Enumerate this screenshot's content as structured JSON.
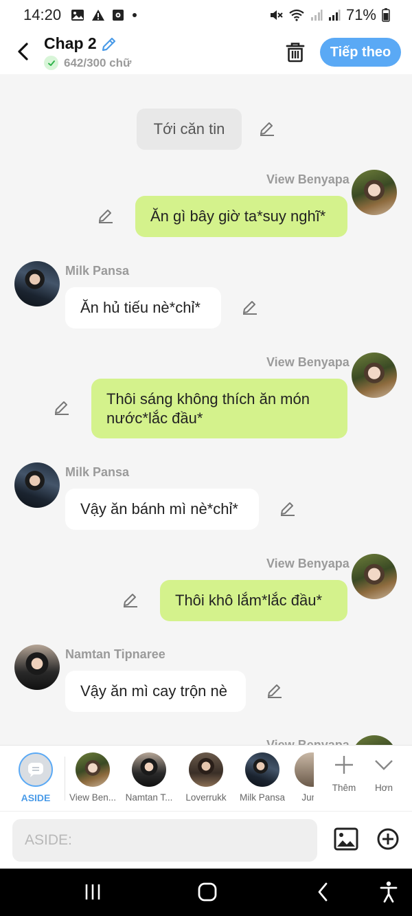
{
  "status_bar": {
    "time": "14:20",
    "battery": "71%",
    "icons": [
      "image-icon",
      "warning-icon",
      "clipboard-icon",
      "dot-icon",
      "mute-icon",
      "wifi-icon",
      "signal-icon",
      "signal-icon",
      "battery-icon"
    ]
  },
  "header": {
    "title": "Chap 2",
    "word_count": "642/300 chữ",
    "next_label": "Tiếp theo",
    "accent_color": "#5aa9f5"
  },
  "messages": [
    {
      "type": "narration",
      "text": "Tới căn tin"
    },
    {
      "type": "right",
      "sender": "View Benyapa",
      "text": "Ăn gì bây giờ ta*suy nghĩ*"
    },
    {
      "type": "left",
      "sender": "Milk Pansa",
      "text": "Ăn hủ tiếu nè*chỉ*"
    },
    {
      "type": "right",
      "sender": "View Benyapa",
      "lines": [
        "Thôi sáng không thích ăn món",
        "nước*lắc đầu*"
      ]
    },
    {
      "type": "left",
      "sender": "Milk Pansa",
      "text": "Vậy ăn bánh mì nè*chỉ*"
    },
    {
      "type": "right",
      "sender": "View Benyapa",
      "text": "Thôi khô lắm*lắc đầu*"
    },
    {
      "type": "left",
      "sender": "Namtan Tipnaree",
      "text": "Vậy ăn mì cay trộn nè"
    },
    {
      "type": "right",
      "sender": "View Benyapa",
      "text": ""
    }
  ],
  "characters": {
    "aside_label": "ASIDE",
    "items": [
      "View Ben...",
      "Namtan T...",
      "Loverrukk",
      "Milk Pansa",
      "June"
    ],
    "more_add": "Thêm",
    "more_more": "Hơn"
  },
  "input": {
    "placeholder": "ASIDE:"
  },
  "colors": {
    "right_bubble": "#d4f28c",
    "left_bubble": "#ffffff",
    "narration": "#e8e8e8"
  }
}
